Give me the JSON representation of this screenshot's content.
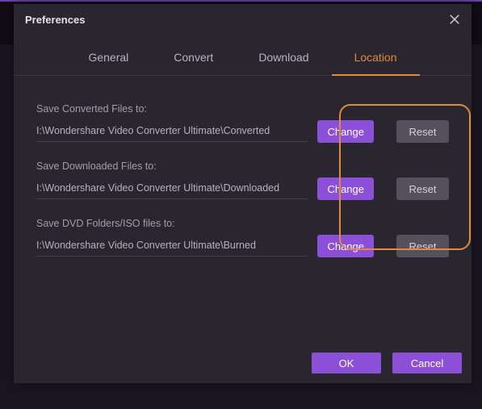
{
  "dialog": {
    "title": "Preferences"
  },
  "tabs": {
    "general": "General",
    "convert": "Convert",
    "download": "Download",
    "location": "Location",
    "activeIndex": 3
  },
  "location": {
    "rows": [
      {
        "label": "Save Converted Files to:",
        "value": "I:\\Wondershare Video Converter Ultimate\\Converted",
        "change": "Change",
        "reset": "Reset"
      },
      {
        "label": "Save Downloaded Files to:",
        "value": "I:\\Wondershare Video Converter Ultimate\\Downloaded",
        "change": "Change",
        "reset": "Reset"
      },
      {
        "label": "Save DVD Folders/ISO files to:",
        "value": "I:\\Wondershare Video Converter Ultimate\\Burned",
        "change": "Change",
        "reset": "Reset"
      }
    ]
  },
  "footer": {
    "ok": "OK",
    "cancel": "Cancel"
  },
  "colors": {
    "accent": "#e08b3c",
    "primaryBtn": "#8b4fd8"
  }
}
